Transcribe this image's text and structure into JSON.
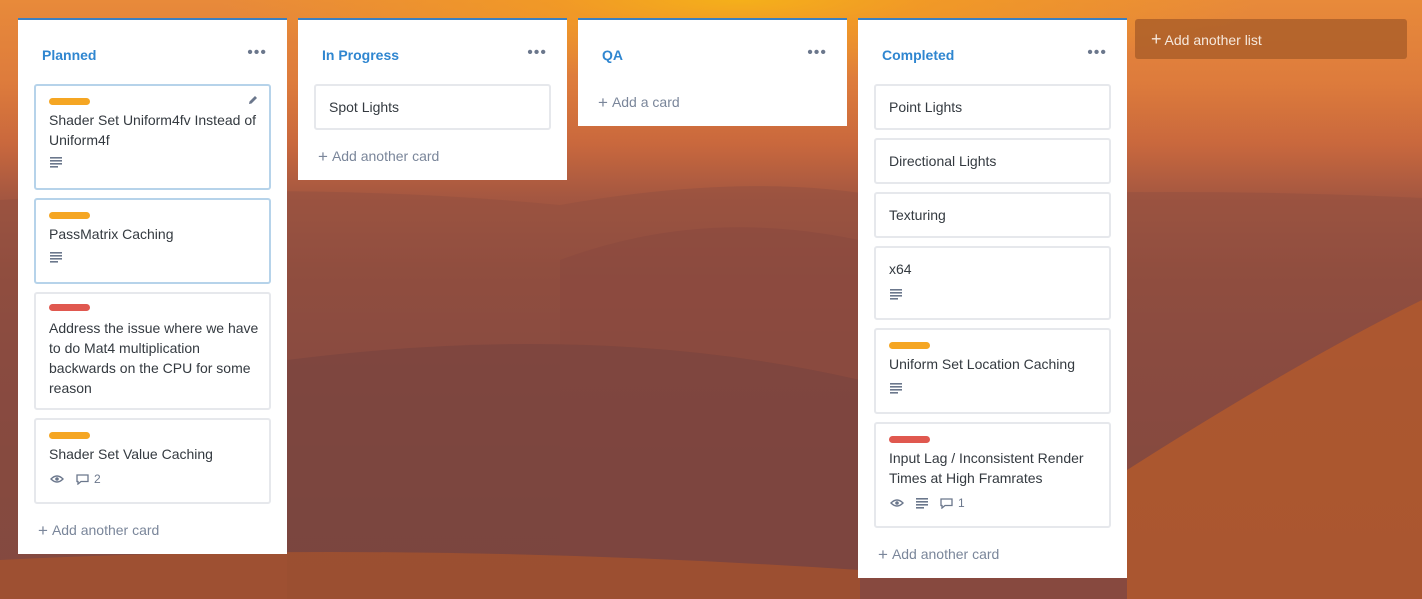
{
  "board": {
    "add_list_label": "Add another list",
    "accent_color": "#2f86d0",
    "label_colors": {
      "orange": "#f5a623",
      "red": "#e0584f"
    }
  },
  "lists": [
    {
      "title": "Planned",
      "add_label": "Add another card",
      "cards": [
        {
          "text": "Shader Set Uniform4fv Instead of Uniform4f",
          "label": "orange"
        },
        {
          "text": "PassMatrix Caching",
          "label": "orange"
        },
        {
          "text": "Address the issue where we have to do Mat4 multiplication backwards on the CPU for some reason",
          "label": "red"
        },
        {
          "text": "Shader Set Value Caching",
          "label": "orange",
          "comments": "2"
        }
      ]
    },
    {
      "title": "In Progress",
      "add_label": "Add another card",
      "cards": [
        {
          "text": "Spot Lights"
        }
      ]
    },
    {
      "title": "QA",
      "add_label": "Add a card",
      "cards": []
    },
    {
      "title": "Completed",
      "add_label": "Add another card",
      "cards": [
        {
          "text": "Point Lights"
        },
        {
          "text": "Directional Lights"
        },
        {
          "text": "Texturing"
        },
        {
          "text": "x64"
        },
        {
          "text": "Uniform Set Location Caching",
          "label": "orange"
        },
        {
          "text": "Input Lag / Inconsistent Render Times at High Framrates",
          "label": "red",
          "comments": "1"
        }
      ]
    }
  ]
}
